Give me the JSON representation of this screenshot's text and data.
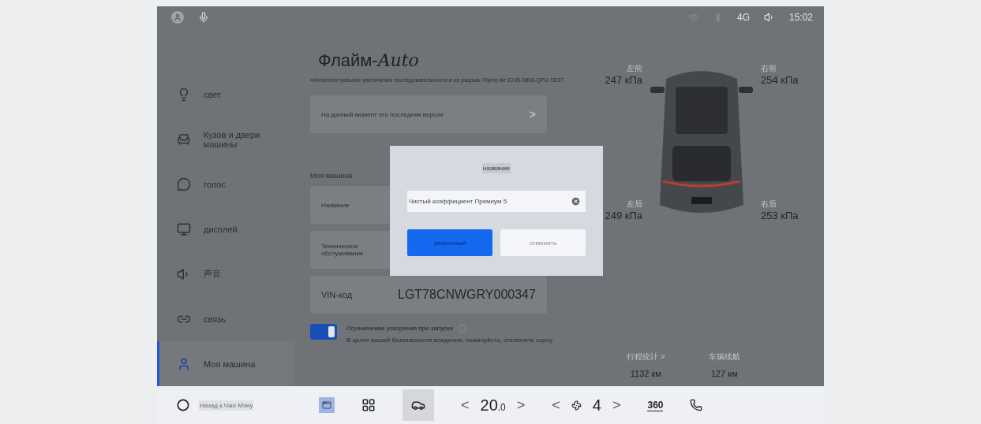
{
  "status_bar": {
    "time": "15:02",
    "network": "4G"
  },
  "sidebar": {
    "items": [
      {
        "label": "свет",
        "selected": false
      },
      {
        "label": "Кузов и двери машины",
        "selected": false
      },
      {
        "label": "голос",
        "selected": false
      },
      {
        "label": "дисплей",
        "selected": false
      },
      {
        "label": "声音",
        "selected": false
      },
      {
        "label": "связь",
        "selected": false
      },
      {
        "label": "Моя машина",
        "selected": true
      }
    ]
  },
  "header": {
    "logo_text": "Флайм-",
    "logo_script": "Auto",
    "version": "«Интеллектуальное увеличение последовательности и ее разрыв: Flyme Air E245-0808-QPU-TEST"
  },
  "update_row": {
    "label": "На данный момент это последняя версия",
    "chevron": ">"
  },
  "my_car": {
    "title": "Моя машина",
    "rows": [
      {
        "label": "Название",
        "value": ""
      },
      {
        "label": "Техническое обслуживание",
        "value": ""
      },
      {
        "label": "VIN-код",
        "value": "LGT78CNWGRY000347"
      }
    ]
  },
  "acceleration": {
    "label": "Ограничение ускорения при запуске",
    "description": "В целях вашей безопасности вождения, пожалуйста, отключите сцену",
    "on": true
  },
  "tires": [
    {
      "position": "左前",
      "pressure": "247 кПа"
    },
    {
      "position": "右前",
      "pressure": "254 кПа"
    },
    {
      "position": "左后",
      "pressure": "249 кПа"
    },
    {
      "position": "右后",
      "pressure": "253 кПа"
    }
  ],
  "stats": [
    {
      "label": "行程统计 >",
      "value": "1132 км"
    },
    {
      "label": "车辆续航",
      "value": "127 км"
    }
  ],
  "dialog": {
    "title": "название",
    "input_value": "Чистый коэффициент Премиум 5",
    "confirm": "уверенный",
    "cancel": "отменить"
  },
  "dock": {
    "back_label": "Назад к Чжо Мэну",
    "car_selected": true,
    "temperature": "20",
    "temperature_decimal": ".0",
    "fan_level": "4",
    "view_360": "360",
    "prev": "<",
    "next": ">"
  }
}
